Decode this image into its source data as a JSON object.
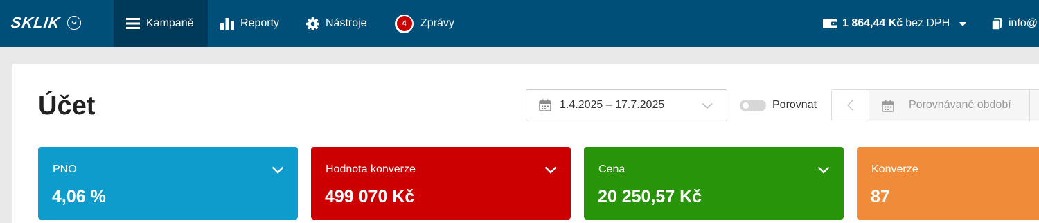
{
  "topbar": {
    "logo": "SKLIK",
    "nav": [
      {
        "label": "Kampaně",
        "icon": "menu-icon",
        "active": true
      },
      {
        "label": "Reporty",
        "icon": "bar-chart-icon",
        "active": false
      },
      {
        "label": "Nástroje",
        "icon": "gear-icon",
        "active": false
      },
      {
        "label": "Zprávy",
        "icon": "messages-badge-icon",
        "badge": "4",
        "active": false
      }
    ],
    "credit": {
      "icon": "wallet-icon",
      "amount": "1 864,44 Kč",
      "suffix": "bez DPH"
    },
    "user": {
      "icon": "copy-icon",
      "label": "info@"
    }
  },
  "page": {
    "title": "Účet",
    "date_range": "1.4.2025 – 17.7.2025",
    "compare_label": "Porovnat",
    "compare_placeholder": "Porovnávané období"
  },
  "colors": {
    "topbar": "#004f79",
    "nav_active": "#003a5b",
    "card_pno": "#0e9ccd",
    "card_conversion_value": "#cc0000",
    "card_cost": "#279409",
    "card_conversions": "#f08c39"
  },
  "cards": [
    {
      "label": "PNO",
      "value": "4,06 %"
    },
    {
      "label": "Hodnota konverze",
      "value": "499 070 Kč"
    },
    {
      "label": "Cena",
      "value": "20 250,57 Kč"
    },
    {
      "label": "Konverze",
      "value": "87"
    }
  ]
}
